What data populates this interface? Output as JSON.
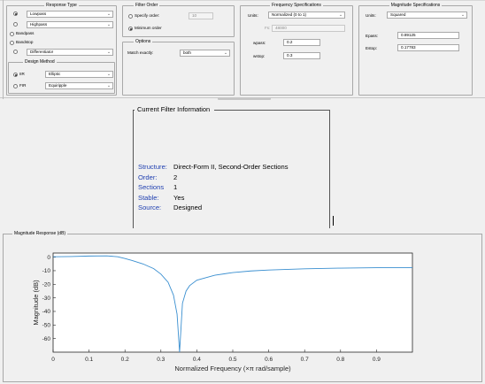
{
  "response_type": {
    "title": "Response Type",
    "options": [
      {
        "label": "Lowpass",
        "selected": true,
        "has_dropdown": true
      },
      {
        "label": "Highpass",
        "selected": false,
        "has_dropdown": true
      },
      {
        "label": "Bandpass",
        "selected": false,
        "has_dropdown": false
      },
      {
        "label": "Bandstop",
        "selected": false,
        "has_dropdown": false
      },
      {
        "label": "Differentiator",
        "selected": false,
        "has_dropdown": true
      }
    ]
  },
  "design_method": {
    "title": "Design Method",
    "iir_label": "IIR",
    "iir_value": "Elliptic",
    "fir_label": "FIR",
    "fir_value": "Equiripple"
  },
  "filter_order": {
    "title": "Filter Order",
    "specify_label": "Specify order:",
    "specify_value": "10",
    "minimum_label": "Minimum order"
  },
  "options": {
    "title": "Options",
    "match_label": "Match exactly:",
    "match_value": "both"
  },
  "frequency_specs": {
    "title": "Frequency Specifications",
    "units_label": "Units:",
    "units_value": "Normalized (0 to 1)",
    "fs_label": "Fs:",
    "fs_value": "48000",
    "wpass_label": "wpass:",
    "wpass_value": "0.2",
    "wstop_label": "wstop:",
    "wstop_value": "0.3"
  },
  "magnitude_specs": {
    "title": "Magnitude Specifications",
    "units_label": "Units:",
    "units_value": "Squared",
    "epass_label": "Epass:",
    "epass_value": "0.89125",
    "estop_label": "Estop:",
    "estop_value": "0.17783"
  },
  "filter_info": {
    "title": "Current Filter Information",
    "rows": [
      {
        "key": "Structure:",
        "value": "Direct-Form II, Second-Order Sections"
      },
      {
        "key": "Order:",
        "value": "2"
      },
      {
        "key": "Sections",
        "value": "1"
      },
      {
        "key": "Stable:",
        "value": "Yes"
      },
      {
        "key": "Source:",
        "value": "Designed"
      }
    ]
  },
  "magnitude_panel": {
    "title": "Magnitude Response (dB)"
  },
  "chart_data": {
    "type": "line",
    "title": "",
    "xlabel": "Normalized Frequency (×π rad/sample)",
    "ylabel": "Magnitude (dB)",
    "xlim": [
      0,
      1
    ],
    "ylim": [
      -70,
      3
    ],
    "xticks": [
      0,
      0.1,
      0.2,
      0.3,
      0.4,
      0.5,
      0.6,
      0.7,
      0.8,
      0.9
    ],
    "xtick_labels": [
      "0",
      "0.1",
      "0.2",
      "0.3",
      "0.4",
      "0.5",
      "0.6",
      "0.7",
      "0.8",
      "0.9"
    ],
    "yticks": [
      0,
      -10,
      -20,
      -30,
      -40,
      -50,
      -60
    ],
    "ytick_labels": [
      "0",
      "-10",
      "-20",
      "-30",
      "-40",
      "-50",
      "-60"
    ],
    "grid": false,
    "series": [
      {
        "color": "#3a8fd0",
        "x": [
          0,
          0.05,
          0.1,
          0.15,
          0.18,
          0.2,
          0.22,
          0.25,
          0.28,
          0.3,
          0.32,
          0.335,
          0.345,
          0.352,
          0.36,
          0.37,
          0.38,
          0.4,
          0.45,
          0.5,
          0.55,
          0.6,
          0.7,
          0.8,
          0.9,
          1.0
        ],
        "y": [
          0.3,
          0.45,
          0.8,
          0.9,
          0.3,
          -1.0,
          -2.5,
          -5.0,
          -8.5,
          -12.5,
          -18.5,
          -28.0,
          -42.0,
          -70.0,
          -34.0,
          -25.0,
          -21.0,
          -17.0,
          -13.3,
          -11.4,
          -10.2,
          -9.5,
          -8.6,
          -8.1,
          -7.8,
          -7.7
        ]
      }
    ]
  }
}
